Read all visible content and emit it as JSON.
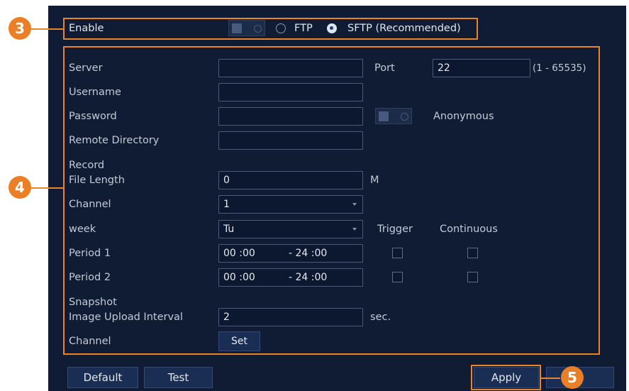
{
  "enable_row": {
    "label": "Enable",
    "options": [
      "FTP",
      "SFTP (Recommended)"
    ],
    "selected": "SFTP (Recommended)"
  },
  "form": {
    "server_label": "Server",
    "server_value": "",
    "port_label": "Port",
    "port_value": "22",
    "port_range": "(1 - 65535)",
    "username_label": "Username",
    "username_value": "",
    "password_label": "Password",
    "password_value": "",
    "anonymous_label": "Anonymous",
    "remote_dir_label": "Remote Directory",
    "remote_dir_value": "",
    "record_label": "Record",
    "file_length_label": "File Length",
    "file_length_value": "0",
    "file_length_unit": "M",
    "channel_label": "Channel",
    "channel_value": "1",
    "week_label": "week",
    "week_value": "Tu",
    "trigger_label": "Trigger",
    "continuous_label": "Continuous",
    "periods": [
      {
        "label": "Period 1",
        "start": "00 :00",
        "end": "- 24 :00"
      },
      {
        "label": "Period 2",
        "start": "00 :00",
        "end": "- 24 :00"
      }
    ],
    "snapshot_label": "Snapshot",
    "upload_interval_label": "Image Upload Interval",
    "upload_interval_value": "2",
    "upload_interval_unit": "sec.",
    "snapshot_channel_label": "Channel",
    "set_label": "Set"
  },
  "buttons": {
    "default": "Default",
    "test": "Test",
    "apply": "Apply"
  },
  "callouts": {
    "step3": "3",
    "step4": "4",
    "step5": "5"
  },
  "colors": {
    "panel_bg": "#0f1c33",
    "field_border": "#4a5a78",
    "accent_orange": "#e8852a",
    "button_bg": "#1a2d52"
  }
}
